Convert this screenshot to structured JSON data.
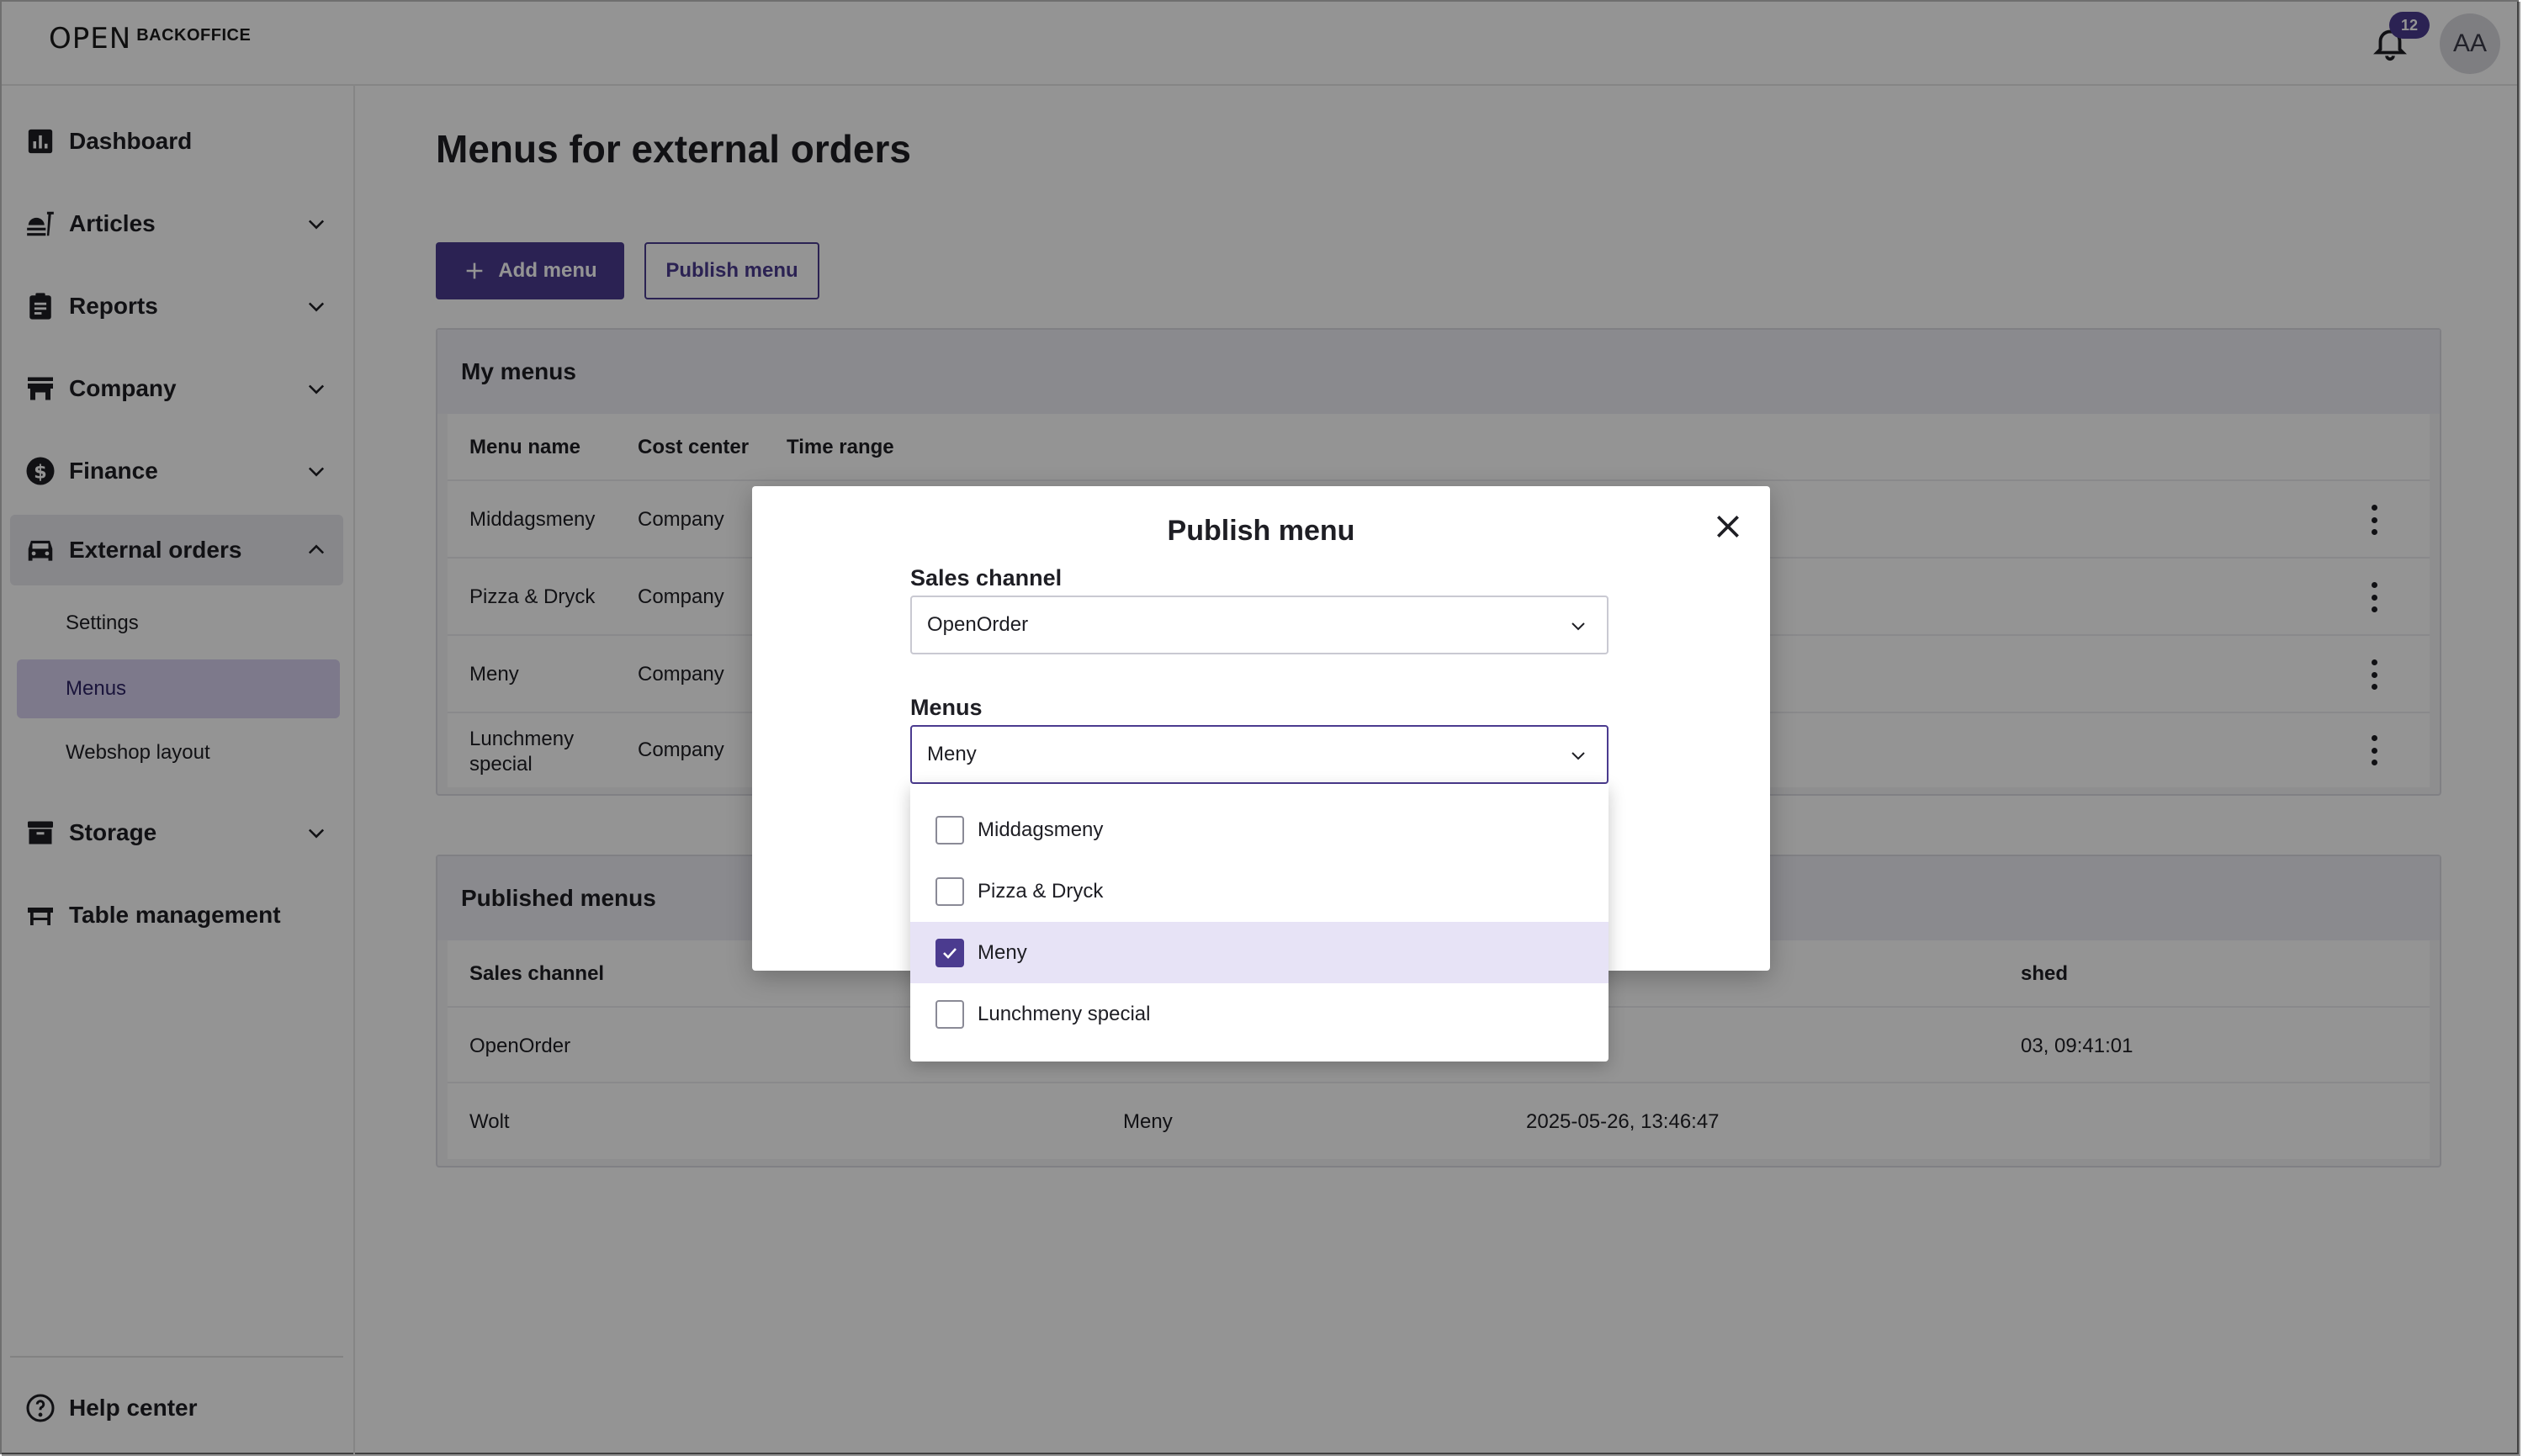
{
  "app": {
    "logo_mark": "OPEN",
    "logo_text": "BACKOFFICE",
    "notification_count": "12",
    "avatar_initials": "AA"
  },
  "sidebar": {
    "items": [
      {
        "label": "Dashboard",
        "icon": "bar-chart-icon"
      },
      {
        "label": "Articles",
        "icon": "food-icon"
      },
      {
        "label": "Reports",
        "icon": "clipboard-icon"
      },
      {
        "label": "Company",
        "icon": "store-icon"
      },
      {
        "label": "Finance",
        "icon": "dollar-icon"
      },
      {
        "label": "External orders",
        "icon": "car-icon"
      },
      {
        "label": "Storage",
        "icon": "archive-icon"
      },
      {
        "label": "Table management",
        "icon": "table-icon"
      }
    ],
    "sub_items": [
      {
        "label": "Settings"
      },
      {
        "label": "Menus"
      },
      {
        "label": "Webshop layout"
      }
    ],
    "help": "Help center"
  },
  "main": {
    "title": "Menus for external orders",
    "add_menu_label": "Add menu",
    "publish_menu_label": "Publish menu",
    "my_menus": {
      "title": "My menus",
      "columns": [
        "Menu name",
        "Cost center",
        "Time range"
      ],
      "rows": [
        {
          "name": "Middagsmeny",
          "cost_center": "Company"
        },
        {
          "name": "Pizza & Dryck",
          "cost_center": "Company"
        },
        {
          "name": "Meny",
          "cost_center": "Company"
        },
        {
          "name": "Lunchmeny special",
          "cost_center": "Company"
        }
      ]
    },
    "published_menus": {
      "title": "Published menus",
      "columns": [
        "Sales channel",
        "shed"
      ],
      "rows": [
        {
          "channel": "OpenOrder",
          "menu": "",
          "published": "03, 09:41:01"
        },
        {
          "channel": "Wolt",
          "menu": "Meny",
          "published": "2025-05-26, 13:46:47"
        }
      ]
    }
  },
  "modal": {
    "title": "Publish menu",
    "sales_channel_label": "Sales channel",
    "sales_channel_value": "OpenOrder",
    "menus_label": "Menus",
    "menus_value": "Meny",
    "options": [
      {
        "label": "Middagsmeny",
        "checked": false
      },
      {
        "label": "Pizza & Dryck",
        "checked": false
      },
      {
        "label": "Meny",
        "checked": true
      },
      {
        "label": "Lunchmeny special",
        "checked": false
      }
    ]
  },
  "colors": {
    "accent": "#4b3b8f",
    "selected_bg": "#d7d1ef",
    "overlay": "rgba(0,0,0,0.42)"
  }
}
